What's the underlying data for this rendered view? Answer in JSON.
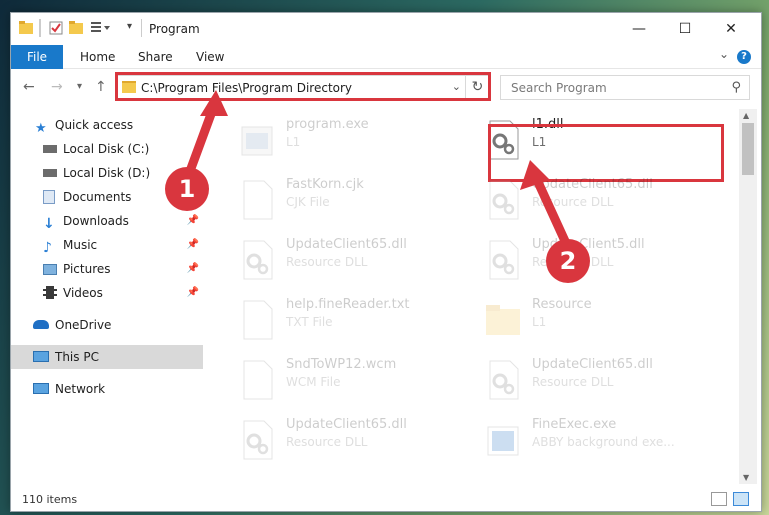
{
  "window": {
    "title": "Program"
  },
  "ribbon": {
    "tabs": [
      "File",
      "Home",
      "Share",
      "View"
    ],
    "help": "?"
  },
  "address": {
    "path": "C:\\Program Files\\Program Directory"
  },
  "search": {
    "placeholder": "Search Program"
  },
  "sidebar": {
    "items": [
      {
        "label": "Quick access",
        "icon": "star-icon"
      },
      {
        "label": "Local Disk (C:)",
        "icon": "drive-icon"
      },
      {
        "label": "Local Disk (D:)",
        "icon": "drive-icon"
      },
      {
        "label": "Documents",
        "icon": "documents-icon"
      },
      {
        "label": "Downloads",
        "icon": "download-icon",
        "pinned": true
      },
      {
        "label": "Music",
        "icon": "music-icon",
        "pinned": true
      },
      {
        "label": "Pictures",
        "icon": "pictures-icon",
        "pinned": true
      },
      {
        "label": "Videos",
        "icon": "videos-icon",
        "pinned": true
      },
      {
        "label": "OneDrive",
        "icon": "cloud-icon"
      },
      {
        "label": "This PC",
        "icon": "computer-icon",
        "selected": true
      },
      {
        "label": "Network",
        "icon": "network-icon"
      }
    ]
  },
  "files": [
    {
      "name": "program.exe",
      "type": "L1",
      "icon": "exe-icon"
    },
    {
      "name": "l1.dll",
      "type": "L1",
      "icon": "dll-gear-icon"
    },
    {
      "name": "FastKorn.cjk",
      "type": "CJK File",
      "icon": "blank-file-icon"
    },
    {
      "name": "UpdateClient65.dll",
      "type": "Resource DLL",
      "icon": "dll-gear-icon"
    },
    {
      "name": "UpdateClient65.dll",
      "type": "Resource DLL",
      "icon": "dll-gear-icon"
    },
    {
      "name": "UpdateClient5.dll",
      "type": "Resource DLL",
      "icon": "dll-gear-icon"
    },
    {
      "name": "help.fineReader.txt",
      "type": "TXT File",
      "icon": "blank-file-icon"
    },
    {
      "name": "Resource",
      "type": "L1",
      "icon": "folder-icon"
    },
    {
      "name": "SndToWP12.wcm",
      "type": "WCM File",
      "icon": "blank-file-icon"
    },
    {
      "name": "UpdateClient65.dll",
      "type": "Resource DLL",
      "icon": "dll-gear-icon"
    },
    {
      "name": "UpdateClient65.dll",
      "type": "Resource DLL",
      "icon": "dll-gear-icon"
    },
    {
      "name": "FineExec.exe",
      "type": "ABBY background exe...",
      "icon": "exe-icon"
    }
  ],
  "status": {
    "count": "110 items"
  },
  "annotations": {
    "badge1": "1",
    "badge2": "2"
  },
  "colors": {
    "accent": "#1979ca",
    "highlight": "#d9363e"
  }
}
